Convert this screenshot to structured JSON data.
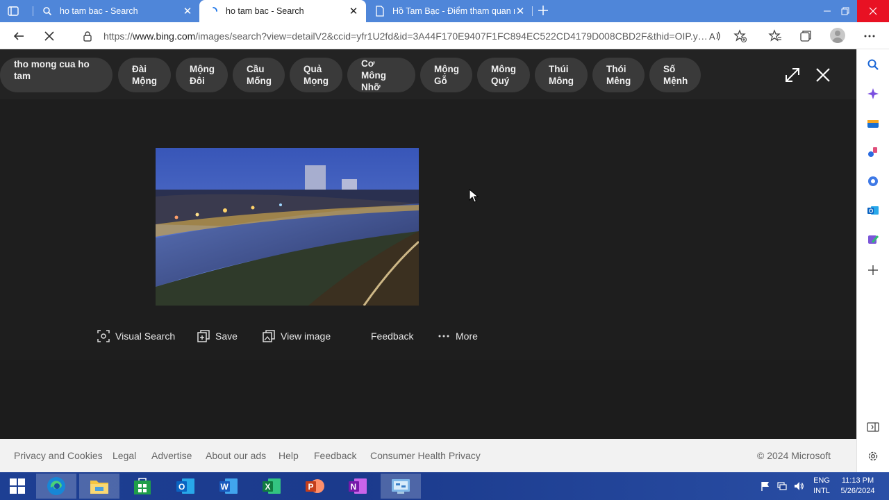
{
  "browser": {
    "tabs": [
      {
        "title": "ho tam bac - Search",
        "icon": "search-icon",
        "active": false
      },
      {
        "title": "ho tam bac - Search",
        "icon": "loading-icon",
        "active": true
      },
      {
        "title": "Hồ Tam Bạc - Điểm tham quan nổi tiếng",
        "icon": "page-icon",
        "active": false
      }
    ],
    "url_prefix": "https://",
    "url_domain": "www.bing.com",
    "url_rest": "/images/search?view=detailV2&ccid=yfr1U2fd&id=3A44F170E9407F1FC894EC522CD4179D008CBD2F&thid=OIP.yf..."
  },
  "chips": [
    {
      "line1": "tho mong cua ho tam",
      "line2": ""
    },
    {
      "line1": "Đài",
      "line2": "Mộng"
    },
    {
      "line1": "Mộng",
      "line2": "Đôi"
    },
    {
      "line1": "Cầu",
      "line2": "Mống"
    },
    {
      "line1": "Quả",
      "line2": "Mọng"
    },
    {
      "line1": "Cơ Mông",
      "line2": "Nhỡ"
    },
    {
      "line1": "Mộng",
      "line2": "Gỗ"
    },
    {
      "line1": "Mông",
      "line2": "Quý"
    },
    {
      "line1": "Thúi",
      "line2": "Mông"
    },
    {
      "line1": "Thói",
      "line2": "Mêng"
    },
    {
      "line1": "Số",
      "line2": "Mệnh"
    }
  ],
  "actions": {
    "visual_search": "Visual Search",
    "save": "Save",
    "view_image": "View image",
    "feedback": "Feedback",
    "more": "More"
  },
  "footer": {
    "links": [
      "Privacy and Cookies",
      "Legal",
      "Advertise",
      "About our ads",
      "Help",
      "Feedback",
      "Consumer Health Privacy"
    ],
    "copyright": "© 2024 Microsoft"
  },
  "taskbar": {
    "lang1": "ENG",
    "lang2": "INTL",
    "time": "11:13 PM",
    "date": "5/26/2024"
  },
  "colors": {
    "tab_strip": "#4f86d9",
    "page_bg": "#1c1c1c",
    "chip_bg": "#3a3a3a",
    "close_red": "#e81123"
  }
}
